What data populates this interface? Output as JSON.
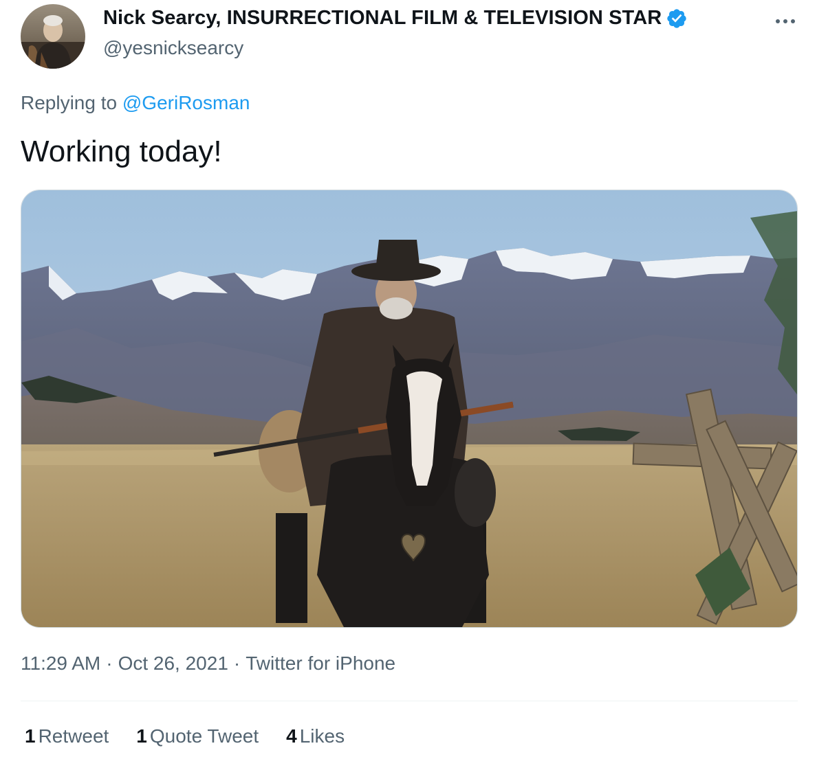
{
  "author": {
    "display_name": "Nick Searcy, INSURRECTIONAL FILM & TELEVISION STAR",
    "handle": "@yesnicksearcy",
    "verified": true,
    "avatar_icon": "profile-avatar"
  },
  "more_icon": "more-dots-icon",
  "reply": {
    "prefix": "Replying to",
    "to_handle": "@GeriRosman"
  },
  "tweet": {
    "text": "Working today!",
    "media_description_icon": "photo"
  },
  "meta": {
    "time": "11:29 AM",
    "date": "Oct 26, 2021",
    "source": "Twitter for iPhone",
    "separator": "·"
  },
  "stats": [
    {
      "count": "1",
      "label": "Retweet"
    },
    {
      "count": "1",
      "label": "Quote Tweet"
    },
    {
      "count": "4",
      "label": "Likes"
    }
  ],
  "colors": {
    "text_primary": "#0f1419",
    "text_secondary": "#536471",
    "link": "#1d9bf0",
    "verified_badge": "#1d9bf0",
    "divider": "#eff3f4"
  }
}
